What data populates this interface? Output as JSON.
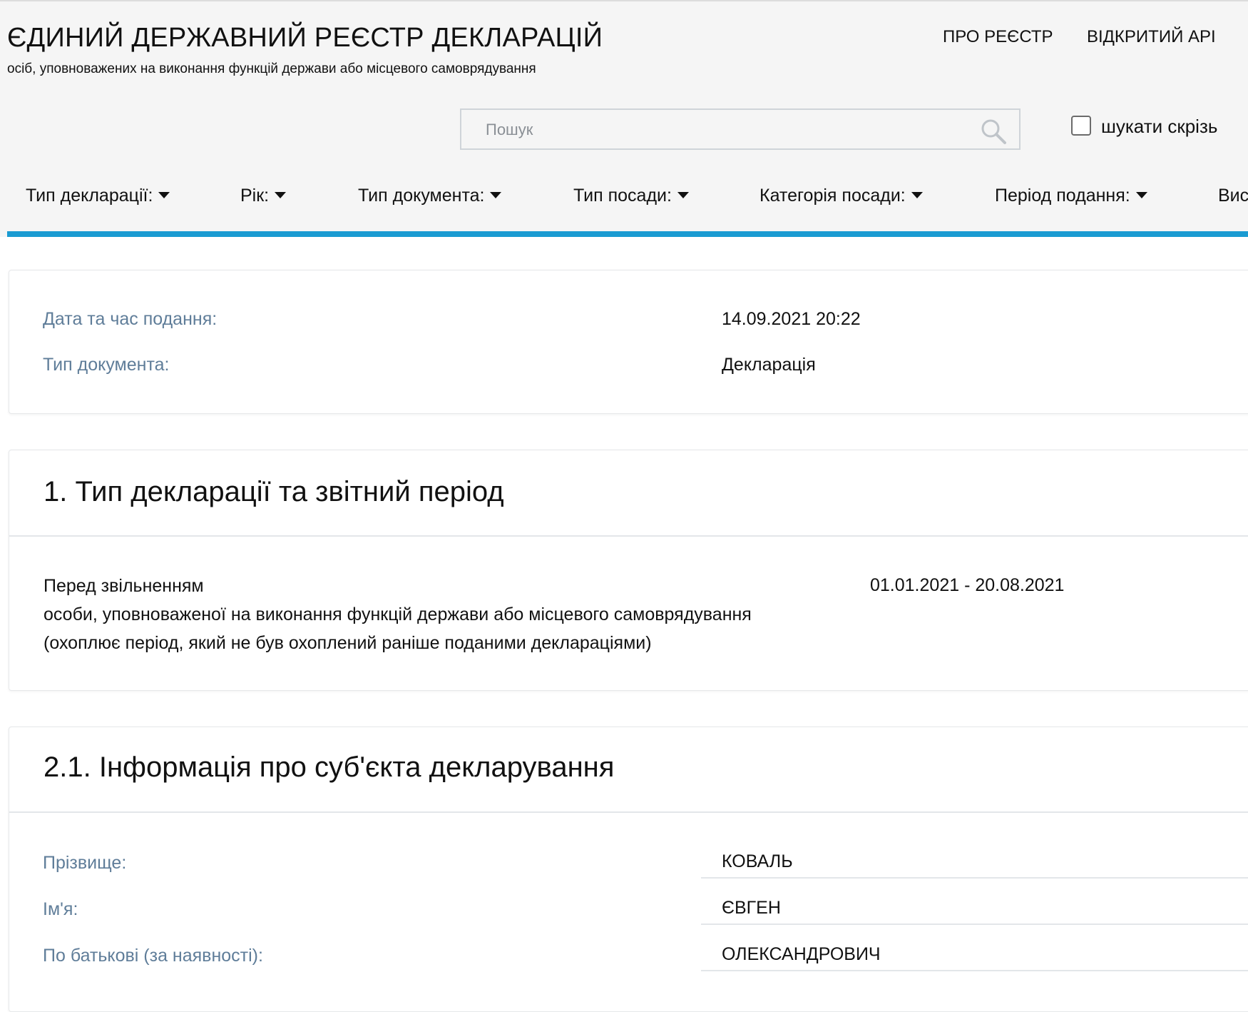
{
  "header": {
    "title": "ЄДИНИЙ ДЕРЖАВНИЙ РЕЄСТР ДЕКЛАРАЦІЙ",
    "subtitle": "осіб, уповноважених на виконання функцій держави або місцевого самоврядування",
    "nav": {
      "about": "ПРО РЕЄСТР",
      "api": "ВІДКРИТИЙ API"
    }
  },
  "search": {
    "placeholder": "Пошук",
    "value": "",
    "search_all_label": "шукати скрізь",
    "search_all_checked": false
  },
  "filters": [
    {
      "label": "Тип декларації:"
    },
    {
      "label": "Рік:"
    },
    {
      "label": "Тип документа:"
    },
    {
      "label": "Тип посади:"
    },
    {
      "label": "Категорія посади:"
    },
    {
      "label": "Період подання:"
    },
    {
      "label": "Вис"
    }
  ],
  "meta": {
    "rows": [
      {
        "label": "Дата та час подання:",
        "value": "14.09.2021 20:22"
      },
      {
        "label": "Тип документа:",
        "value": "Декларація"
      }
    ]
  },
  "section1": {
    "title": "1. Тип декларації та звітний період",
    "lines": [
      "Перед звільненням",
      "особи, уповноваженої на виконання функцій держави або місцевого самоврядування",
      "(охоплює період, який не був охоплений раніше поданими деклараціями)"
    ],
    "period": "01.01.2021 - 20.08.2021"
  },
  "section21": {
    "title": "2.1. Інформація про суб'єкта декларування",
    "rows": [
      {
        "label": "Прізвище:",
        "value": "КОВАЛЬ"
      },
      {
        "label": "Ім'я:",
        "value": "ЄВГЕН"
      },
      {
        "label": "По батькові (за наявності):",
        "value": "ОЛЕКСАНДРОВИЧ"
      }
    ]
  }
}
